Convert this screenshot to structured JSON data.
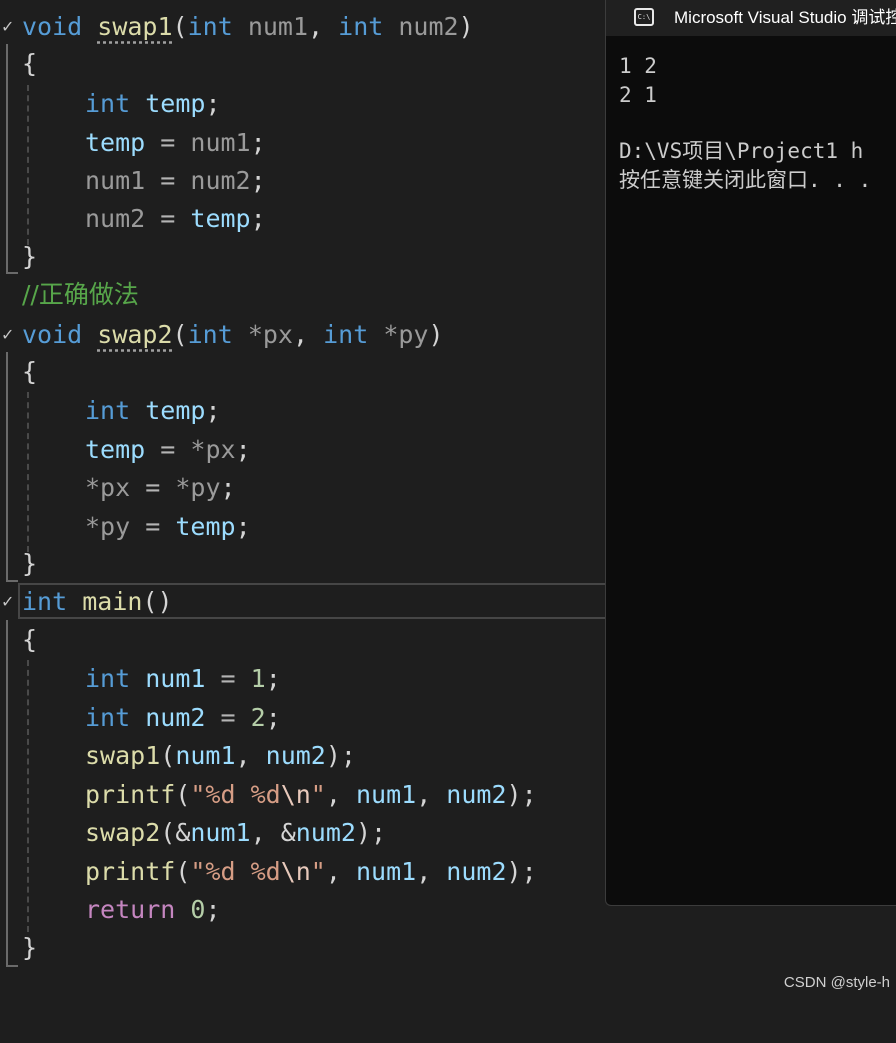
{
  "editor": {
    "comment_correct": "//正确做法",
    "kw_void": "void",
    "kw_int": "int",
    "kw_return": "return",
    "fn_swap1": "swap1",
    "fn_swap2": "swap2",
    "fn_main": "main",
    "fn_printf": "printf",
    "var_temp": "temp",
    "var_num1": "num1",
    "var_num2": "num2",
    "ptr_px": "*px",
    "ptr_py": "*py",
    "val_1": "1",
    "val_2": "2",
    "val_0": "0",
    "fmt_string_prefix": "\"%d %d",
    "fmt_escape": "\\n",
    "fmt_string_suffix": "\"",
    "brace_open": "{",
    "brace_close": "}"
  },
  "console": {
    "title": "Microsoft Visual Studio 调试控制台",
    "icon": "console-window-icon",
    "output_lines": [
      "1 2",
      "2 1",
      "",
      "D:\\VS项目\\Project1 h",
      "按任意键关闭此窗口. . ."
    ]
  },
  "watermark": "CSDN @style-h",
  "colors": {
    "background": "#1e1e1e",
    "keyword": "#569cd6",
    "function": "#dcdcaa",
    "variable": "#9cdcfe",
    "number": "#b5cea8",
    "string": "#d69d85",
    "comment": "#57a64a",
    "control_keyword": "#c586c0"
  }
}
